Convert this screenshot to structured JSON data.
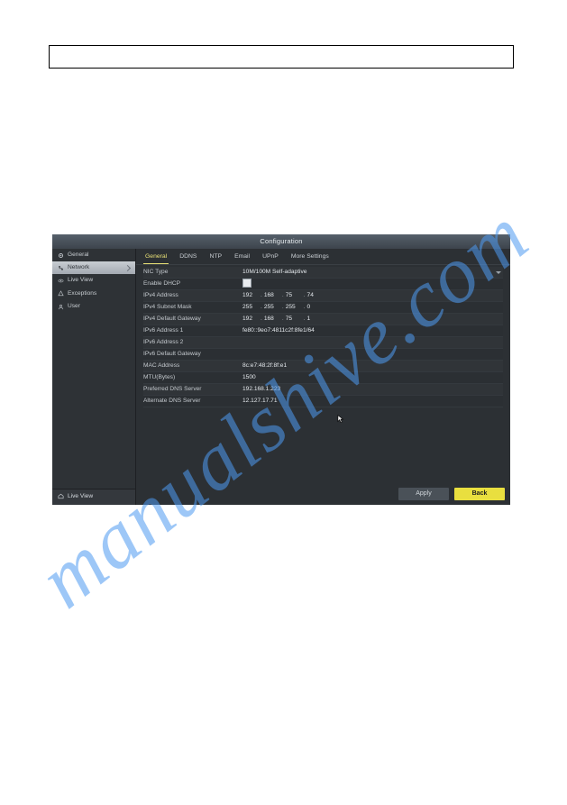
{
  "watermark_text": "manualshive.com",
  "window": {
    "title": "Configuration"
  },
  "sidebar": {
    "items": [
      {
        "icon": "gear-icon",
        "label": "General"
      },
      {
        "icon": "network-icon",
        "label": "Network"
      },
      {
        "icon": "eye-icon",
        "label": "Live View"
      },
      {
        "icon": "alert-icon",
        "label": "Exceptions"
      },
      {
        "icon": "user-icon",
        "label": "User"
      }
    ],
    "bottom": {
      "icon": "home-icon",
      "label": "Live View"
    }
  },
  "tabs": [
    {
      "label": "General"
    },
    {
      "label": "DDNS"
    },
    {
      "label": "NTP"
    },
    {
      "label": "Email"
    },
    {
      "label": "UPnP"
    },
    {
      "label": "More Settings"
    }
  ],
  "form": {
    "nic_type": {
      "label": "NIC Type",
      "value": "10M/100M Self-adaptive"
    },
    "enable_dhcp": {
      "label": "Enable DHCP",
      "checked": false
    },
    "ipv4_address": {
      "label": "IPv4 Address",
      "o1": "192",
      "o2": "168",
      "o3": "75",
      "o4": "74"
    },
    "ipv4_subnet": {
      "label": "IPv4 Subnet Mask",
      "o1": "255",
      "o2": "255",
      "o3": "255",
      "o4": "0"
    },
    "ipv4_gateway": {
      "label": "IPv4 Default Gateway",
      "o1": "192",
      "o2": "168",
      "o3": "75",
      "o4": "1"
    },
    "ipv6_address1": {
      "label": "IPv6 Address 1",
      "value": "fe80::9eo7:4811c2f:8fe1/64"
    },
    "ipv6_address2": {
      "label": "IPv6 Address 2",
      "value": ""
    },
    "ipv6_gateway": {
      "label": "IPv6 Default Gateway",
      "value": ""
    },
    "mac_address": {
      "label": "MAC Address",
      "value": "8c:e7:48:2f:8f:e1"
    },
    "mtu": {
      "label": "MTU(Bytes)",
      "value": "1500"
    },
    "preferred_dns": {
      "label": "Preferred DNS Server",
      "value": "192.168.1.223"
    },
    "alternate_dns": {
      "label": "Alternate DNS Server",
      "value": "12.127.17.71"
    }
  },
  "buttons": {
    "apply": "Apply",
    "back": "Back"
  }
}
